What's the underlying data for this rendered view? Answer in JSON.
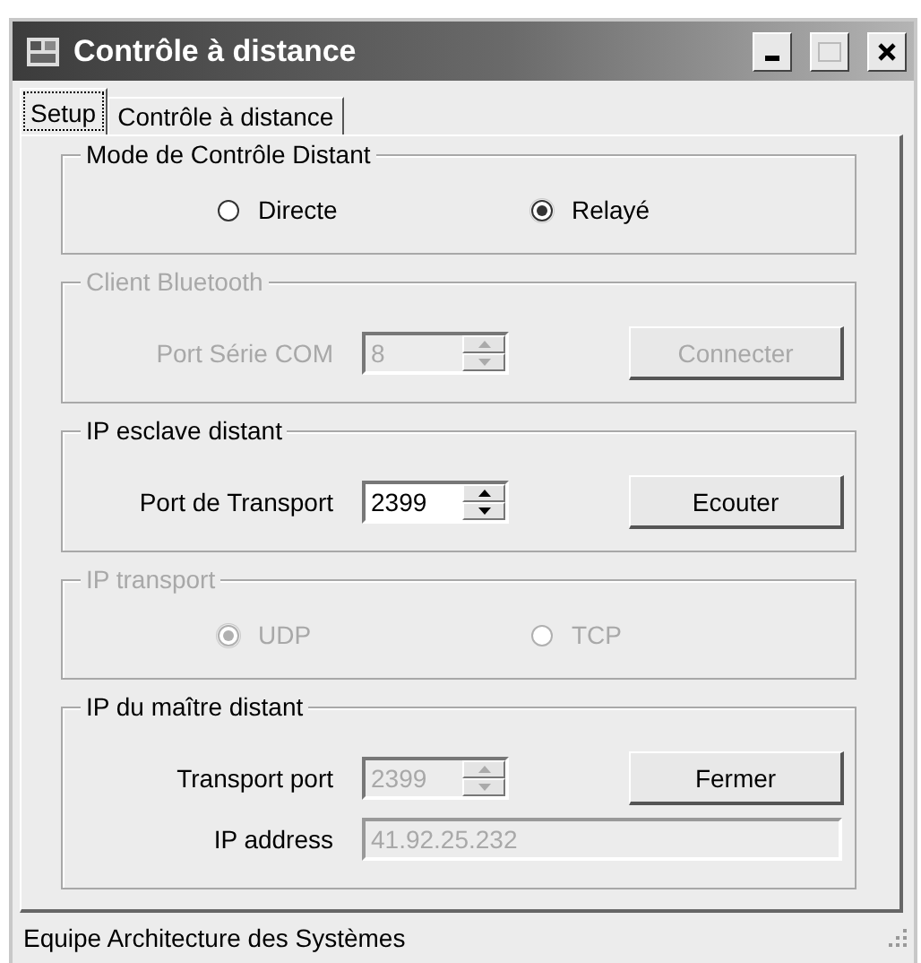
{
  "window": {
    "title": "Contrôle à distance"
  },
  "tabs": [
    {
      "label": "Setup",
      "selected": true
    },
    {
      "label": "Contrôle à distance",
      "selected": false
    }
  ],
  "groups": [
    {
      "title": "Mode de Contrôle Distant",
      "disabled": false,
      "rows": [
        {
          "kind": "radios",
          "options": [
            {
              "label": "Directe",
              "selected": false
            },
            {
              "label": "Relayé",
              "selected": true
            }
          ]
        }
      ]
    },
    {
      "title": "Client Bluetooth",
      "disabled": true,
      "rows": [
        {
          "kind": "spin",
          "label": "Port Série COM",
          "value": "8",
          "disabled": true,
          "button": "Connecter",
          "button_disabled": true
        }
      ]
    },
    {
      "title": "IP esclave distant",
      "disabled": false,
      "rows": [
        {
          "kind": "spin",
          "label": "Port de Transport",
          "value": "2399",
          "disabled": false,
          "button": "Ecouter",
          "button_disabled": false
        }
      ]
    },
    {
      "title": "IP transport",
      "disabled": true,
      "rows": [
        {
          "kind": "radios",
          "options": [
            {
              "label": "UDP",
              "selected": true
            },
            {
              "label": "TCP",
              "selected": false
            }
          ]
        }
      ]
    },
    {
      "title": "IP du maître distant",
      "disabled": false,
      "rows": [
        {
          "kind": "spin",
          "label": "Transport port",
          "value": "2399",
          "disabled": true,
          "button": "Fermer",
          "button_disabled": false
        },
        {
          "kind": "text",
          "label": "IP address",
          "value": "41.92.25.232",
          "disabled": true
        }
      ]
    }
  ],
  "status_bar": {
    "text": "Equipe Architecture des Systèmes"
  }
}
